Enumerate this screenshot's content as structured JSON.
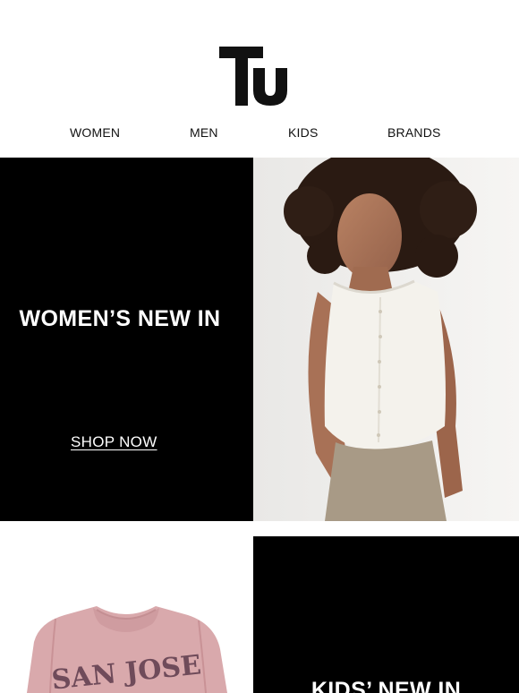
{
  "brand": {
    "logo_text": "Tu"
  },
  "nav": {
    "items": [
      {
        "label": "WOMEN"
      },
      {
        "label": "MEN"
      },
      {
        "label": "KIDS"
      },
      {
        "label": "BRANDS"
      }
    ]
  },
  "women": {
    "title": "WOMEN’S NEW IN",
    "cta": "SHOP NOW",
    "colors": {
      "panel": "#000000",
      "text": "#ffffff"
    }
  },
  "kids": {
    "title": "KIDS’ NEW IN",
    "sweatshirt_print": "SAN JOSE",
    "colors": {
      "panel": "#000000",
      "sweatshirt": "#d9a9ac",
      "print": "#6f4b5a"
    }
  }
}
